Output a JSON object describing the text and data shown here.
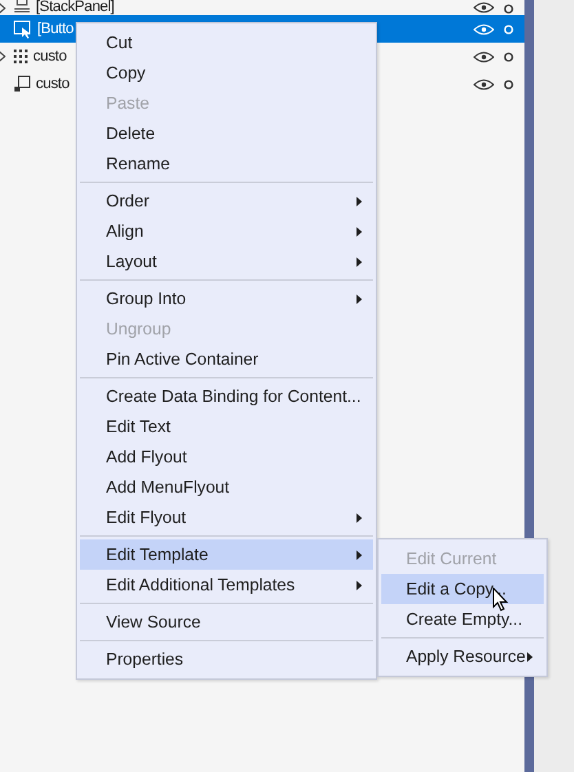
{
  "tree_rows": [
    {
      "label": "[StackPanel]",
      "kind": "stack",
      "expandable": true,
      "selected": false
    },
    {
      "label": "[Butto",
      "kind": "button",
      "expandable": false,
      "selected": true
    },
    {
      "label": "custo",
      "kind": "grid",
      "expandable": true,
      "selected": false
    },
    {
      "label": "custo",
      "kind": "control",
      "expandable": false,
      "selected": false
    }
  ],
  "context_menu": [
    {
      "kind": "item",
      "label": "Cut",
      "disabled": false,
      "submenu": false,
      "selected": false
    },
    {
      "kind": "item",
      "label": "Copy",
      "disabled": false,
      "submenu": false,
      "selected": false
    },
    {
      "kind": "item",
      "label": "Paste",
      "disabled": true,
      "submenu": false,
      "selected": false
    },
    {
      "kind": "item",
      "label": "Delete",
      "disabled": false,
      "submenu": false,
      "selected": false
    },
    {
      "kind": "item",
      "label": "Rename",
      "disabled": false,
      "submenu": false,
      "selected": false
    },
    {
      "kind": "separator"
    },
    {
      "kind": "item",
      "label": "Order",
      "disabled": false,
      "submenu": true,
      "selected": false
    },
    {
      "kind": "item",
      "label": "Align",
      "disabled": false,
      "submenu": true,
      "selected": false
    },
    {
      "kind": "item",
      "label": "Layout",
      "disabled": false,
      "submenu": true,
      "selected": false
    },
    {
      "kind": "separator"
    },
    {
      "kind": "item",
      "label": "Group Into",
      "disabled": false,
      "submenu": true,
      "selected": false
    },
    {
      "kind": "item",
      "label": "Ungroup",
      "disabled": true,
      "submenu": false,
      "selected": false
    },
    {
      "kind": "item",
      "label": "Pin Active Container",
      "disabled": false,
      "submenu": false,
      "selected": false
    },
    {
      "kind": "separator"
    },
    {
      "kind": "item",
      "label": "Create Data Binding for Content...",
      "disabled": false,
      "submenu": false,
      "selected": false
    },
    {
      "kind": "item",
      "label": "Edit Text",
      "disabled": false,
      "submenu": false,
      "selected": false
    },
    {
      "kind": "item",
      "label": "Add Flyout",
      "disabled": false,
      "submenu": false,
      "selected": false
    },
    {
      "kind": "item",
      "label": "Add MenuFlyout",
      "disabled": false,
      "submenu": false,
      "selected": false
    },
    {
      "kind": "item",
      "label": "Edit Flyout",
      "disabled": false,
      "submenu": true,
      "selected": false
    },
    {
      "kind": "separator"
    },
    {
      "kind": "item",
      "label": "Edit Template",
      "disabled": false,
      "submenu": true,
      "selected": true
    },
    {
      "kind": "item",
      "label": "Edit Additional Templates",
      "disabled": false,
      "submenu": true,
      "selected": false
    },
    {
      "kind": "separator"
    },
    {
      "kind": "item",
      "label": "View Source",
      "disabled": false,
      "submenu": false,
      "selected": false
    },
    {
      "kind": "separator"
    },
    {
      "kind": "item",
      "label": "Properties",
      "disabled": false,
      "submenu": false,
      "selected": false
    }
  ],
  "submenu": [
    {
      "kind": "item",
      "label": "Edit Current",
      "disabled": true,
      "submenu": false,
      "selected": false
    },
    {
      "kind": "item",
      "label": "Edit a Copy...",
      "disabled": false,
      "submenu": false,
      "selected": true
    },
    {
      "kind": "item",
      "label": "Create Empty...",
      "disabled": false,
      "submenu": false,
      "selected": false
    },
    {
      "kind": "separator"
    },
    {
      "kind": "item",
      "label": "Apply Resource",
      "disabled": false,
      "submenu": true,
      "selected": false
    }
  ]
}
